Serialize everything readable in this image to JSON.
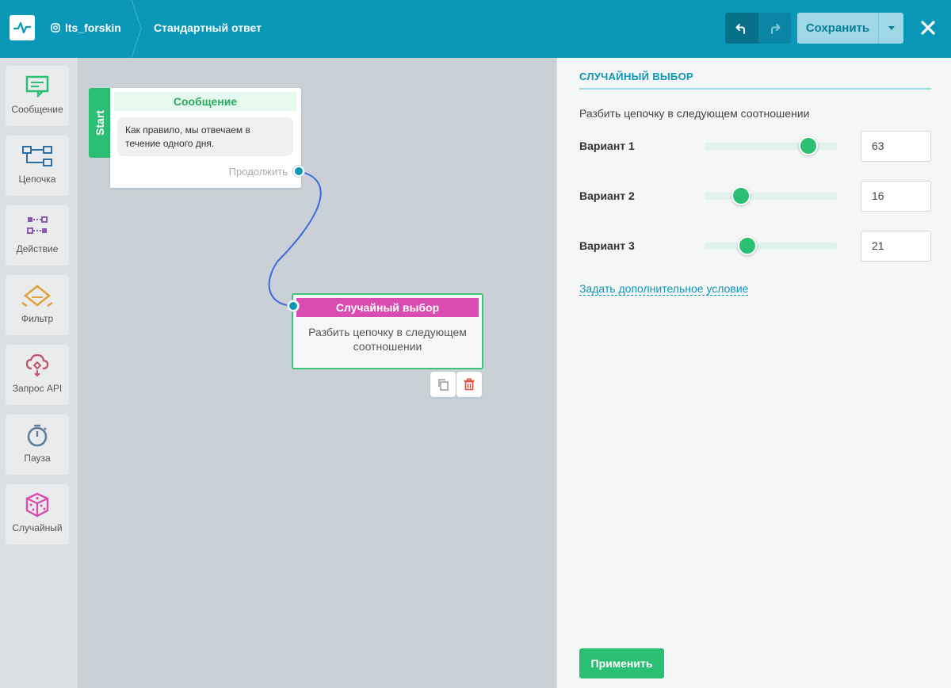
{
  "header": {
    "account": "lts_forskin",
    "flow_title": "Стандартный ответ",
    "save_label": "Сохранить"
  },
  "sidebar": {
    "items": [
      {
        "label": "Сообщение",
        "icon": "message-icon",
        "color": "#2bbf74"
      },
      {
        "label": "Цепочка",
        "icon": "chain-icon",
        "color": "#2f6fa8"
      },
      {
        "label": "Действие",
        "icon": "action-icon",
        "color": "#8a5bb0"
      },
      {
        "label": "Фильтр",
        "icon": "filter-icon",
        "color": "#e0a03a"
      },
      {
        "label": "Запрос API",
        "icon": "api-cloud-icon",
        "color": "#c0566b"
      },
      {
        "label": "Пауза",
        "icon": "stopwatch-icon",
        "color": "#607d9b"
      },
      {
        "label": "Случайный",
        "icon": "dice-icon",
        "color": "#d94db3"
      }
    ]
  },
  "canvas": {
    "start_label": "Start",
    "message_node": {
      "title": "Сообщение",
      "text": "Как правило, мы отвечаем в течение одного дня.",
      "continue_label": "Продолжить"
    },
    "random_node": {
      "title": "Случайный выбор",
      "text": "Разбить цепочку в следующем соотношении"
    }
  },
  "panel": {
    "title": "СЛУЧАЙНЫЙ ВЫБОР",
    "description": "Разбить цепочку в следующем соотношении",
    "variants": [
      {
        "label": "Вариант 1",
        "value": "63",
        "fraction": 0.63
      },
      {
        "label": "Вариант 2",
        "value": "16",
        "fraction": 0.16
      },
      {
        "label": "Вариант 3",
        "value": "21",
        "fraction": 0.21
      }
    ],
    "add_condition": "Задать дополнительное условие",
    "apply_label": "Применить"
  },
  "colors": {
    "brand": "#0a97b8",
    "accent_green": "#2bbf74",
    "random_magenta": "#d94db3"
  }
}
